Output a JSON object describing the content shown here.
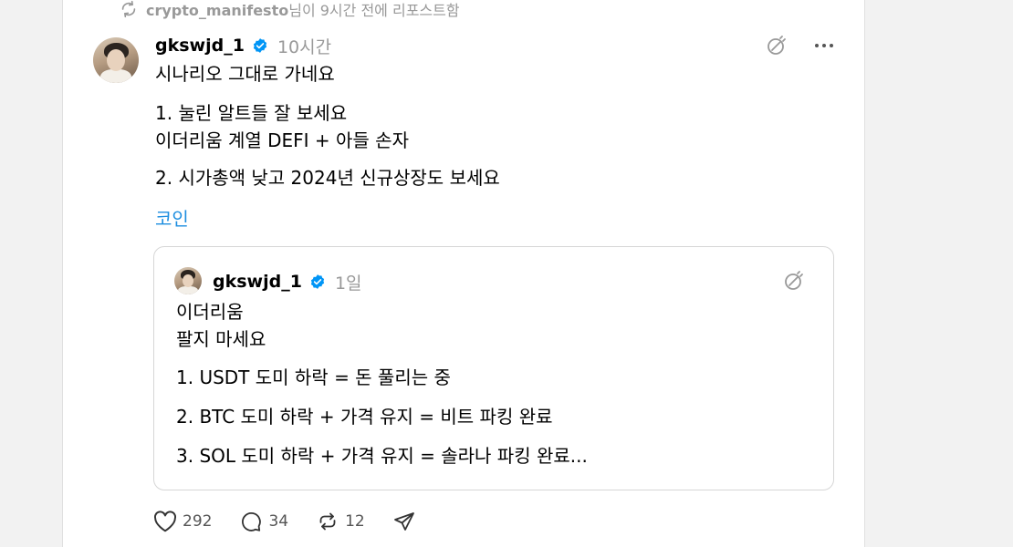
{
  "repost": {
    "user": "crypto_manifesto",
    "text": "님이 9시간 전에 리포스트함",
    "icon": "repost-icon"
  },
  "post": {
    "username": "gkswjd_1",
    "verified": true,
    "time": "10시간",
    "lines": [
      "시나리오 그대로 가네요",
      "1. 눌린 알트들 잘 보세요",
      "이더리움 계열 DEFI + 아들 손자",
      "2. 시가총액 낮고 2024년 신규상장도 보세요"
    ],
    "tag": "코인"
  },
  "quote": {
    "username": "gkswjd_1",
    "verified": true,
    "time": "1일",
    "lines": [
      "이더리움",
      "팔지 마세요",
      "1. USDT 도미 하락 = 돈 풀리는 중",
      "2. BTC 도미 하락 + 가격 유지 = 비트 파킹 완료",
      "3. SOL 도미 하락 + 가격 유지 = 솔라나 파킹 완료..."
    ]
  },
  "actions": {
    "likes": "292",
    "comments": "34",
    "reposts": "12"
  },
  "colors": {
    "link": "#1e8ee0",
    "verified": "#0095f6",
    "muted": "#999999"
  }
}
